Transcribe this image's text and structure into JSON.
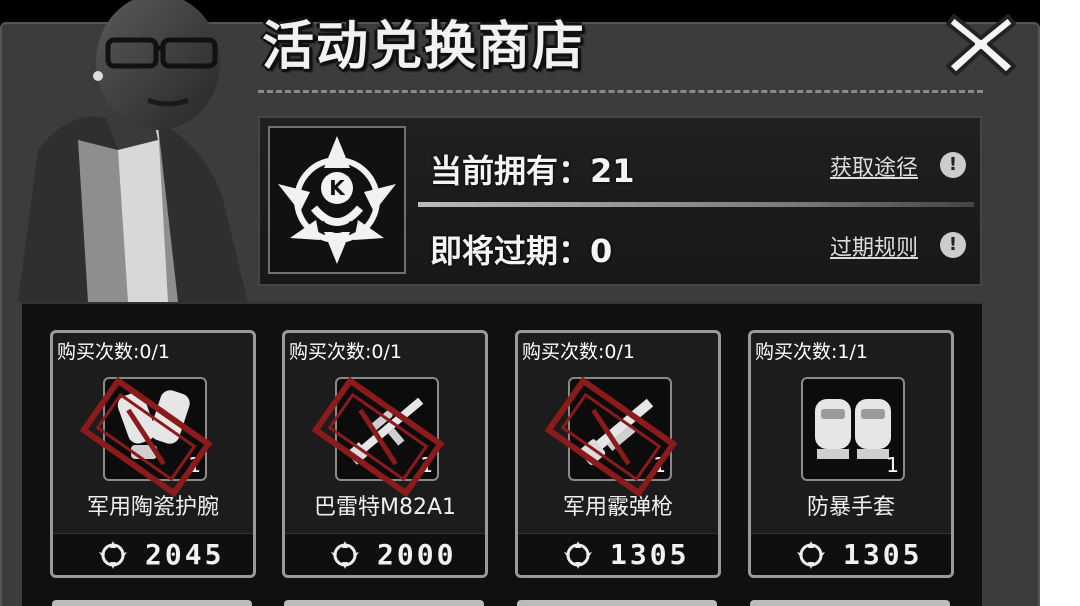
{
  "shop": {
    "title": "活动兑换商店",
    "close_icon": "close-x-icon"
  },
  "currency": {
    "emblem_icon": "k-emblem-icon",
    "emblem_letter": "K",
    "owned_label": "当前拥有：21",
    "owned_link": "获取途径",
    "expiring_label": "即将过期：0",
    "expiring_link": "过期规则",
    "info_glyph": "!"
  },
  "items": [
    {
      "limit": "购买次数:0/1",
      "name": "军用陶瓷护腕",
      "count": "1",
      "price": "2045",
      "icon": "ceramic-bracer-icon",
      "sold_out": true
    },
    {
      "limit": "购买次数:0/1",
      "name": "巴雷特M82A1",
      "count": "1",
      "price": "2000",
      "icon": "sniper-rifle-icon",
      "sold_out": true
    },
    {
      "limit": "购买次数:0/1",
      "name": "军用霰弹枪",
      "count": "1",
      "price": "1305",
      "icon": "shotgun-icon",
      "sold_out": true
    },
    {
      "limit": "购买次数:1/1",
      "name": "防暴手套",
      "count": "1",
      "price": "1305",
      "icon": "riot-gloves-icon",
      "sold_out": false
    }
  ],
  "colors": {
    "panel": "#3c3c3c",
    "stamp": "#8b1a1a",
    "card_border": "#9a9a9a"
  }
}
